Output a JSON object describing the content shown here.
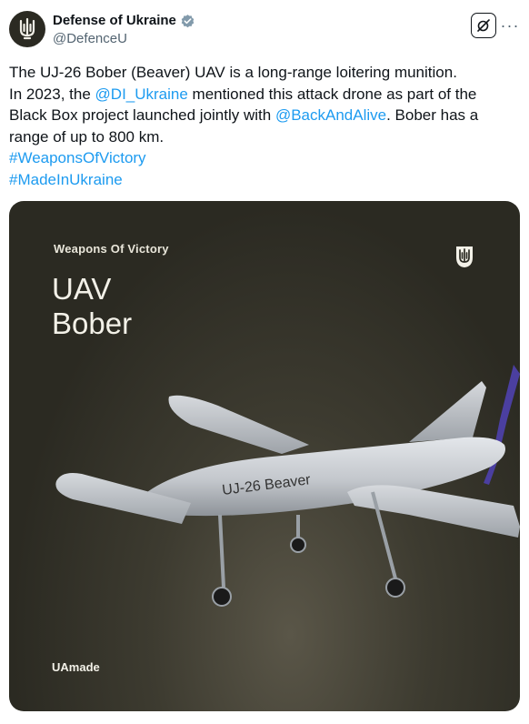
{
  "author": {
    "display_name": "Defense of Ukraine",
    "handle": "@DefenceU",
    "verified_icon": "verified-badge-icon",
    "avatar_icon": "trident-emblem-icon"
  },
  "actions": {
    "grok_icon": "grok-icon",
    "more_label": "···"
  },
  "tweet": {
    "line1": "The UJ-26 Bober (Beaver) UAV is a long-range loitering munition.",
    "line2_pre": "In 2023, the ",
    "mention1": "@DI_Ukraine",
    "line2_post": " mentioned this attack drone as part of the",
    "line3_pre": "Black Box project launched jointly with ",
    "mention2": "@BackAndAlive",
    "line3_post": ". Bober has a",
    "line4": "range of up to 800 km.",
    "hashtag1": "#WeaponsOfVictory",
    "hashtag2": "#MadeInUkraine"
  },
  "media": {
    "kicker": "Weapons Of Victory",
    "title_line1": "UAV",
    "title_line2": "Bober",
    "drone_label": "UJ-26 Beaver",
    "footer": "UAmade",
    "emblem_icon": "trident-emblem-icon"
  },
  "colors": {
    "link": "#1d9bf0",
    "media_bg": "#2b2a22",
    "text": "#0f1419",
    "secondary": "#536471"
  }
}
